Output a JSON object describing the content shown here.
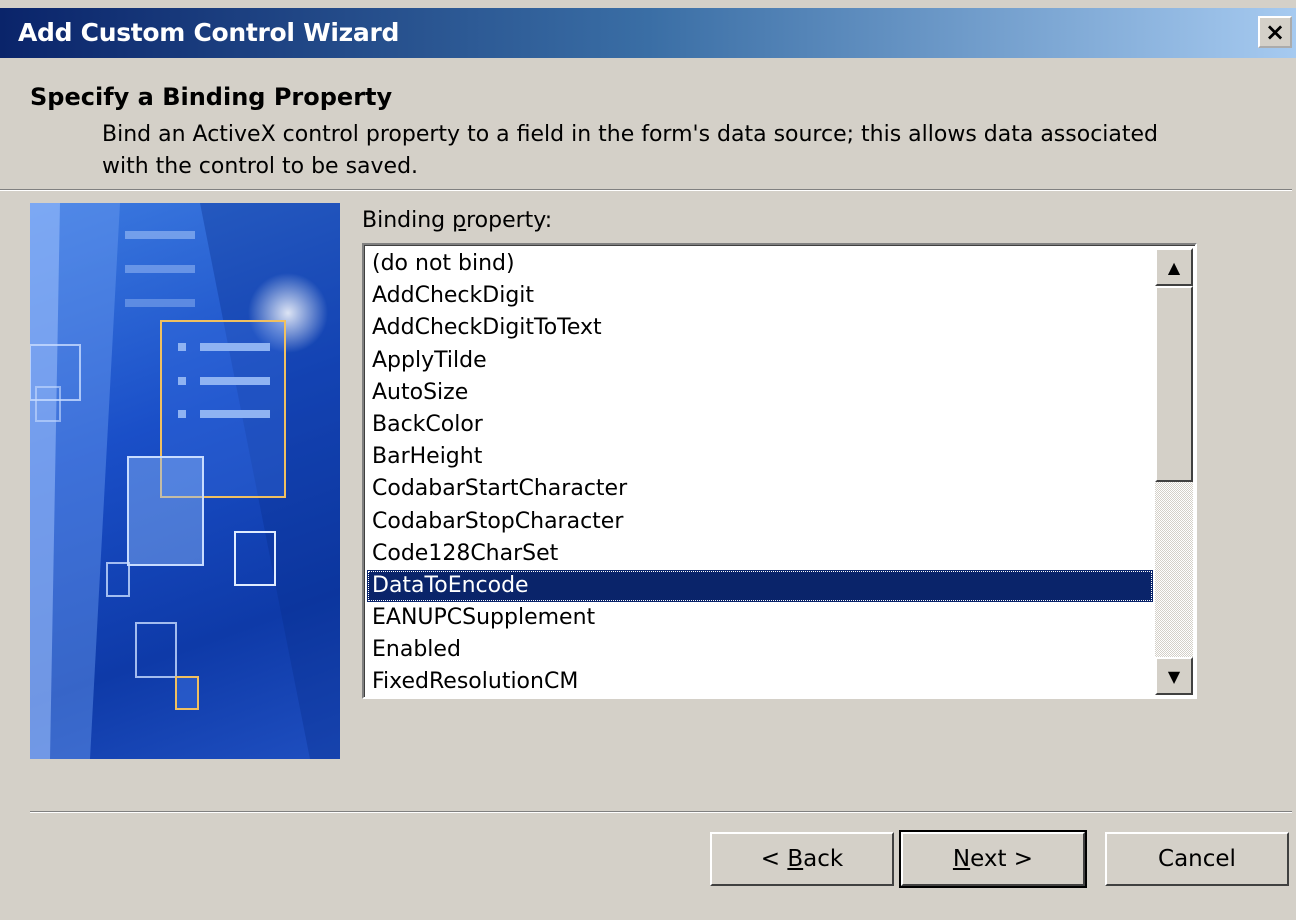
{
  "window": {
    "title": "Add Custom Control Wizard",
    "close_label": "×"
  },
  "header": {
    "title": "Specify a Binding Property",
    "description": "Bind an ActiveX control property to a field in the form's data source; this allows data associated with the control to be saved."
  },
  "list": {
    "label_prefix": "Binding ",
    "label_underlined": "p",
    "label_suffix": "roperty:",
    "items": [
      "(do not bind)",
      "AddCheckDigit",
      "AddCheckDigitToText",
      "ApplyTilde",
      "AutoSize",
      "BackColor",
      "BarHeight",
      "CodabarStartCharacter",
      "CodabarStopCharacter",
      "Code128CharSet",
      "DataToEncode",
      "EANUPCSupplement",
      "Enabled",
      "FixedResolutionCM"
    ],
    "selected_index": 10,
    "scroll_up_glyph": "▲",
    "scroll_down_glyph": "▼"
  },
  "buttons": {
    "back_prefix": "< ",
    "back_underlined": "B",
    "back_suffix": "ack",
    "next_underlined": "N",
    "next_suffix": "ext >",
    "cancel": "Cancel"
  },
  "colors": {
    "selection": "#0a246a",
    "dialog_bg": "#d4d0c8"
  }
}
